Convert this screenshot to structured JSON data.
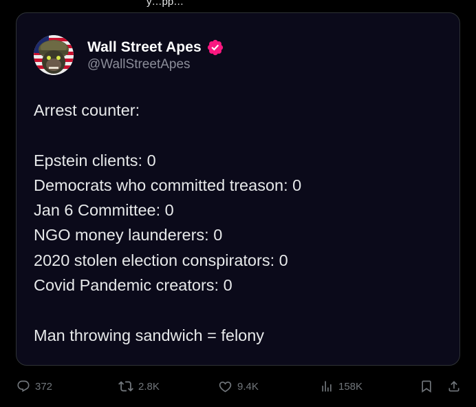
{
  "above_fold_text": "y…pp…",
  "quoted_post": {
    "author": {
      "display_name": "Wall Street Apes",
      "handle": "@WallStreetApes",
      "verified_color": "#f91880"
    },
    "lines": [
      "Arrest counter:",
      "",
      "Epstein clients: 0",
      "Democrats who committed treason: 0",
      "Jan 6 Committee: 0",
      "NGO money launderers: 0",
      "2020 stolen election conspirators: 0",
      "Covid Pandemic creators: 0",
      "",
      "Man throwing sandwich = felony"
    ]
  },
  "actions": {
    "replies": "372",
    "reposts": "2.8K",
    "likes": "9.4K",
    "views": "158K"
  },
  "colors": {
    "card_bg": "#0b0a1a",
    "muted": "#71767b",
    "text": "#e7e9ea"
  }
}
